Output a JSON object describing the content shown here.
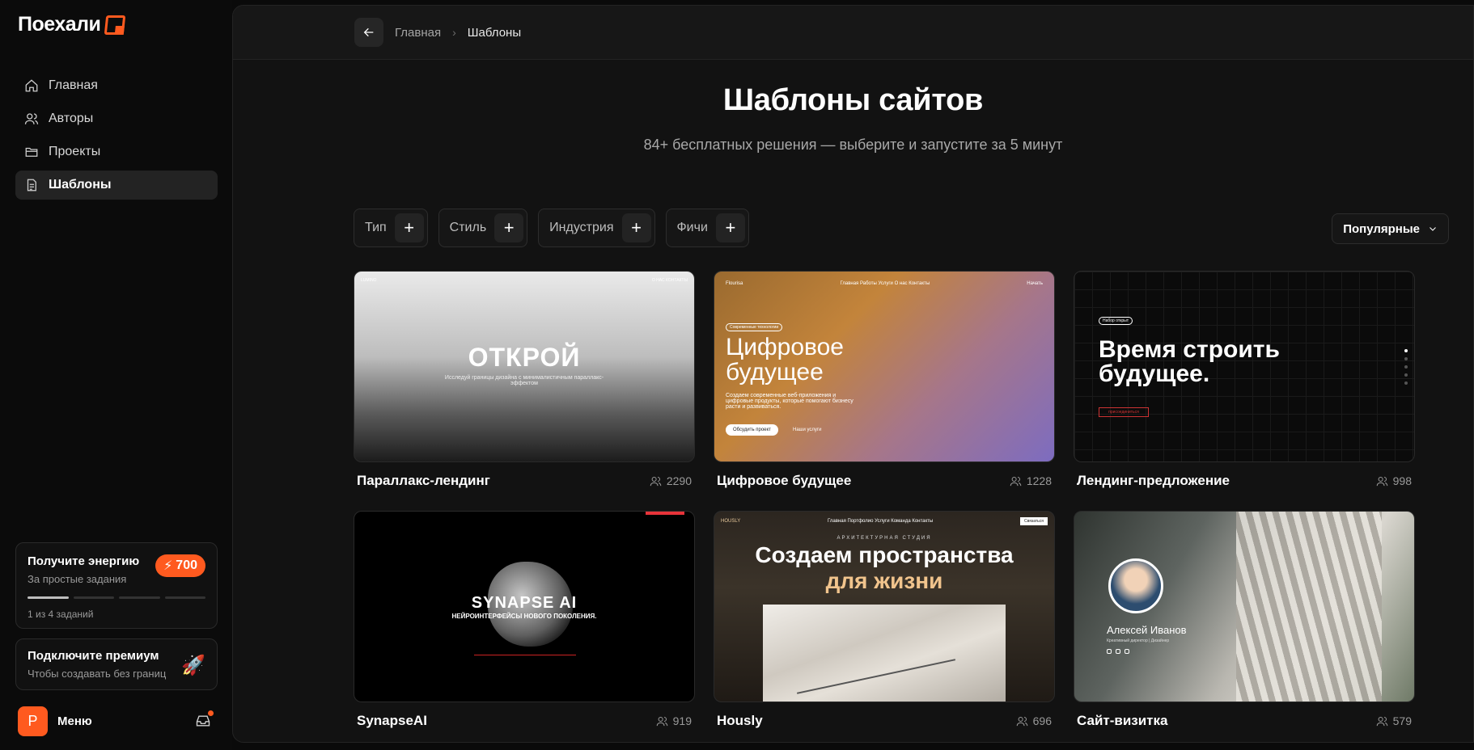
{
  "app": {
    "logo_text": "Поехали"
  },
  "sidebar": {
    "items": [
      {
        "label": "Главная",
        "icon": "home-icon"
      },
      {
        "label": "Авторы",
        "icon": "users-icon"
      },
      {
        "label": "Проекты",
        "icon": "folder-icon"
      },
      {
        "label": "Шаблоны",
        "icon": "document-icon",
        "active": true
      }
    ],
    "energy": {
      "title": "Получите энергию",
      "subtitle": "За простые задания",
      "badge": "700",
      "progress_done": 1,
      "progress_total": 4,
      "count_text": "1 из 4 заданий"
    },
    "premium": {
      "title": "Подключите премиум",
      "subtitle": "Чтобы создавать без границ"
    },
    "user": {
      "avatar_letter": "Р",
      "menu_label": "Меню"
    }
  },
  "breadcrumb": {
    "home": "Главная",
    "current": "Шаблоны"
  },
  "page": {
    "title": "Шаблоны сайтов",
    "subtitle": "84+ бесплатных решения — выберите и запустите за 5 минут"
  },
  "filters": [
    {
      "label": "Тип"
    },
    {
      "label": "Стиль"
    },
    {
      "label": "Индустрия"
    },
    {
      "label": "Фичи"
    }
  ],
  "sort": {
    "label": "Популярные"
  },
  "templates": [
    {
      "name": "Параллакс-лендинг",
      "users": "2290",
      "thumb": {
        "brand": "LUMINO",
        "nav_right": "О НАС    КОНТАКТЫ",
        "headline": "ОТКРОЙ",
        "text": "Исследуй границы дизайна с минималистичным параллакс-эффектом"
      }
    },
    {
      "name": "Цифровое будущее",
      "users": "1228",
      "thumb": {
        "brand": "Flourisa",
        "nav_links": "Главная   Работы   Услуги   О нас   Контакты",
        "nav_cta": "Начать",
        "pill": "Современные технологии",
        "headline1": "Цифровое",
        "headline2": "будущее",
        "text": "Создаем современные веб-приложения и цифровые продукты, которые помогают бизнесу расти и развиваться.",
        "btn1": "Обсудить проект",
        "btn2": "Наши услуги"
      }
    },
    {
      "name": "Лендинг-предложение",
      "users": "998",
      "thumb": {
        "pill": "Набор открыт",
        "headline1": "Время строить",
        "headline2": "будущее.",
        "btn": "присоединиться"
      }
    },
    {
      "name": "SynapseAI",
      "users": "919",
      "thumb": {
        "headline": "SYNAPSE AI",
        "text": "НЕЙРОИНТЕРФЕЙСЫ НОВОГО ПОКОЛЕНИЯ."
      }
    },
    {
      "name": "Hously",
      "users": "696",
      "thumb": {
        "brand": "HOUSLY",
        "nav_links": "Главная   Портфолио   Услуги   Команда   Контакты",
        "cta": "Связаться",
        "tagline": "АРХИТЕКТУРНАЯ СТУДИЯ",
        "headline1": "Создаем пространства",
        "headline2": "для жизни"
      }
    },
    {
      "name": "Сайт-визитка",
      "users": "579",
      "thumb": {
        "person": "Алексей Иванов",
        "role": "Креативный директор | Дизайнер"
      }
    }
  ],
  "colors": {
    "accent": "#ff5a1f",
    "background": "#0a0a0a",
    "panel": "#121212"
  }
}
